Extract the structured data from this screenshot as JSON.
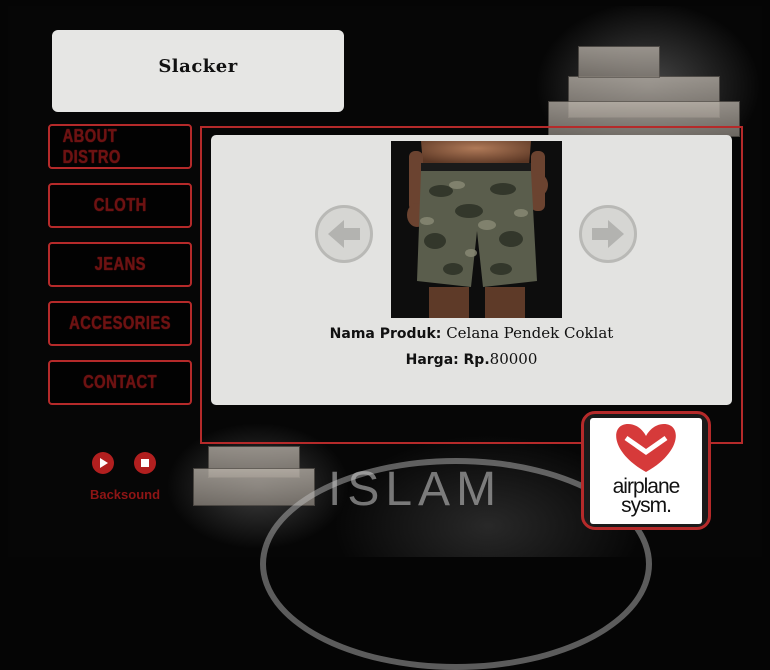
{
  "header": {
    "title": "Slacker"
  },
  "nav": {
    "items": [
      {
        "label": "ABOUT DISTRO"
      },
      {
        "label": "CLOTH"
      },
      {
        "label": "JEANS"
      },
      {
        "label": "ACCESORIES"
      },
      {
        "label": "CONTACT"
      }
    ]
  },
  "product": {
    "name_label": "Nama Produk:",
    "name_value": "Celana Pendek Coklat",
    "price_label": "Harga:",
    "price_prefix": "Rp.",
    "price_value": "80000"
  },
  "audio": {
    "label": "Backsound",
    "play_icon": "play-icon",
    "stop_icon": "stop-icon"
  },
  "logo": {
    "line1": "airplane",
    "line2": "sysm."
  },
  "watermark": {
    "text": "ISLAM"
  },
  "colors": {
    "accent_red": "#b52a2a",
    "panel_bg": "#e3e3e1",
    "nav_text": "#6d1212"
  }
}
